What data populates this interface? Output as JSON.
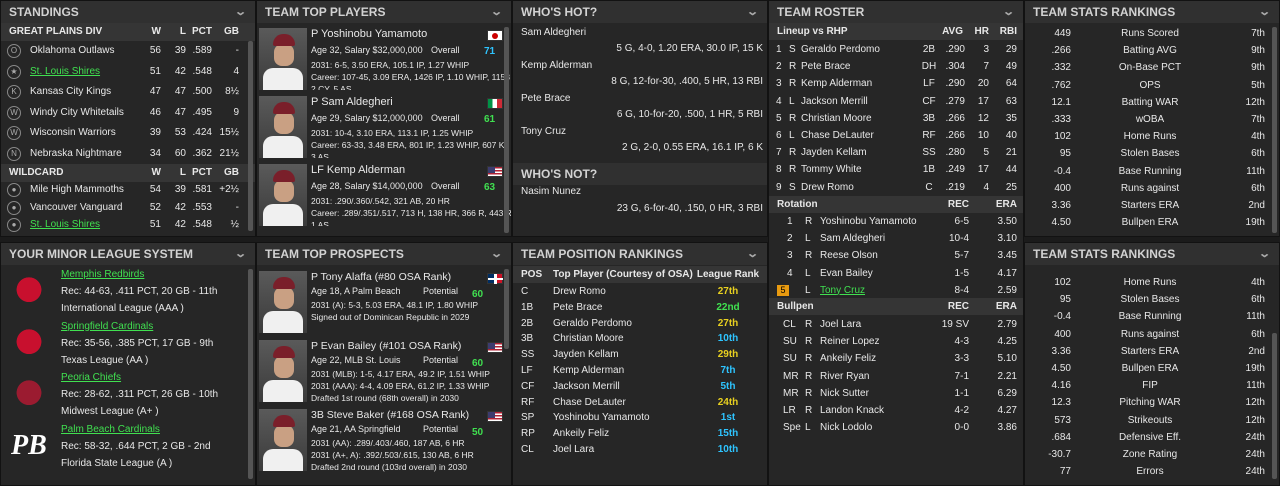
{
  "standings": {
    "title": "STANDINGS",
    "div_name": "GREAT PLAINS DIV",
    "wc_name": "WILDCARD",
    "hdr": {
      "w": "W",
      "l": "L",
      "pct": "PCT",
      "gb": "GB"
    },
    "div": [
      {
        "team": "Oklahoma Outlaws",
        "w": "56",
        "l": "39",
        "pct": ".589",
        "gb": "-"
      },
      {
        "team": "St. Louis Shires",
        "w": "51",
        "l": "42",
        "pct": ".548",
        "gb": "4"
      },
      {
        "team": "Kansas City Kings",
        "w": "47",
        "l": "47",
        "pct": ".500",
        "gb": "8½"
      },
      {
        "team": "Windy City Whitetails",
        "w": "46",
        "l": "47",
        "pct": ".495",
        "gb": "9"
      },
      {
        "team": "Wisconsin Warriors",
        "w": "39",
        "l": "53",
        "pct": ".424",
        "gb": "15½"
      },
      {
        "team": "Nebraska Nightmare",
        "w": "34",
        "l": "60",
        "pct": ".362",
        "gb": "21½"
      }
    ],
    "wc": [
      {
        "team": "Mile High Mammoths",
        "w": "54",
        "l": "39",
        "pct": ".581",
        "gb": "+2½"
      },
      {
        "team": "Vancouver Vanguard",
        "w": "52",
        "l": "42",
        "pct": ".553",
        "gb": "-"
      },
      {
        "team": "St. Louis Shires",
        "w": "51",
        "l": "42",
        "pct": ".548",
        "gb": "½"
      }
    ]
  },
  "top_players": {
    "title": "TEAM TOP PLAYERS",
    "players": [
      {
        "name": "P Yoshinobu Yamamoto",
        "info": "Age 32, Salary $32,000,000",
        "ov_label": "Overall",
        "ov": "71",
        "l1": "2031: 6-5, 3.50 ERA, 105.1 IP, 1.27 WHIP",
        "l2": "Career: 107-45, 3.09 ERA, 1426 IP, 1.10 WHIP, 1153",
        "l3": "2 CY, 5 AS",
        "flag": "jp"
      },
      {
        "name": "P Sam Aldegheri",
        "info": "Age 29, Salary $12,000,000",
        "ov_label": "Overall",
        "ov": "61",
        "l1": "2031: 10-4, 3.10 ERA, 113.1 IP, 1.25 WHIP",
        "l2": "Career: 63-33, 3.48 ERA, 801 IP, 1.23 WHIP, 607 K",
        "l3": "3 AS",
        "flag": "it"
      },
      {
        "name": "LF Kemp Alderman",
        "info": "Age 28, Salary $14,000,000",
        "ov_label": "Overall",
        "ov": "63",
        "l1": "2031: .290/.360/.542, 321 AB, 20 HR",
        "l2": "Career: .289/.351/.517, 713 H, 138 HR, 366 R, 443 R",
        "l3": "1 AS",
        "flag": "us"
      }
    ]
  },
  "whos_hot": {
    "title": "WHO'S HOT?",
    "players": [
      {
        "name": "Sam Aldegheri",
        "stat": "5 G, 4-0, 1.20 ERA, 30.0 IP, 15 K"
      },
      {
        "name": "Kemp Alderman",
        "stat": "8 G, 12-for-30, .400, 5 HR, 13 RBI"
      },
      {
        "name": "Pete Brace",
        "stat": "6 G, 10-for-20, .500, 1 HR, 5 RBI"
      },
      {
        "name": "Tony Cruz",
        "stat": "2 G, 2-0, 0.55 ERA, 16.1 IP, 6 K"
      }
    ],
    "not_title": "WHO'S NOT?",
    "not_players": [
      {
        "name": "Nasim Nunez",
        "stat": "23 G, 6-for-40, .150, 0 HR, 3 RBI"
      }
    ]
  },
  "roster": {
    "title": "TEAM ROSTER",
    "lineup_hdr": "Lineup vs RHP",
    "lh": {
      "avg": "AVG",
      "hr": "HR",
      "rbi": "RBI"
    },
    "lineup": [
      {
        "n": "1",
        "b": "S",
        "name": "Geraldo Perdomo",
        "pos": "2B",
        "avg": ".290",
        "hr": "3",
        "rbi": "29"
      },
      {
        "n": "2",
        "b": "R",
        "name": "Pete Brace",
        "pos": "DH",
        "avg": ".304",
        "hr": "7",
        "rbi": "49"
      },
      {
        "n": "3",
        "b": "R",
        "name": "Kemp Alderman",
        "pos": "LF",
        "avg": ".290",
        "hr": "20",
        "rbi": "64"
      },
      {
        "n": "4",
        "b": "L",
        "name": "Jackson Merrill",
        "pos": "CF",
        "avg": ".279",
        "hr": "17",
        "rbi": "63"
      },
      {
        "n": "5",
        "b": "R",
        "name": "Christian Moore",
        "pos": "3B",
        "avg": ".266",
        "hr": "12",
        "rbi": "35"
      },
      {
        "n": "6",
        "b": "L",
        "name": "Chase DeLauter",
        "pos": "RF",
        "avg": ".266",
        "hr": "10",
        "rbi": "40"
      },
      {
        "n": "7",
        "b": "R",
        "name": "Jayden Kellam",
        "pos": "SS",
        "avg": ".280",
        "hr": "5",
        "rbi": "21"
      },
      {
        "n": "8",
        "b": "R",
        "name": "Tommy White",
        "pos": "1B",
        "avg": ".249",
        "hr": "17",
        "rbi": "44"
      },
      {
        "n": "9",
        "b": "S",
        "name": "Drew Romo",
        "pos": "C",
        "avg": ".219",
        "hr": "4",
        "rbi": "25"
      }
    ],
    "rot_hdr": "Rotation",
    "rh": {
      "rec": "REC",
      "era": "ERA"
    },
    "rotation": [
      {
        "n": "1",
        "t": "R",
        "name": "Yoshinobu Yamamoto",
        "rec": "6-5",
        "era": "3.50"
      },
      {
        "n": "2",
        "t": "L",
        "name": "Sam Aldegheri",
        "rec": "10-4",
        "era": "3.10"
      },
      {
        "n": "3",
        "t": "R",
        "name": "Reese Olson",
        "rec": "5-7",
        "era": "3.45"
      },
      {
        "n": "4",
        "t": "L",
        "name": "Evan Bailey",
        "rec": "1-5",
        "era": "4.17"
      },
      {
        "n": "5",
        "t": "L",
        "name": "Tony Cruz",
        "rec": "8-4",
        "era": "2.59"
      }
    ],
    "bp_hdr": "Bullpen",
    "bh": {
      "rec": "REC",
      "era": "ERA"
    },
    "bullpen": [
      {
        "r": "CL",
        "t": "R",
        "name": "Joel Lara",
        "rec": "19 SV",
        "era": "2.79"
      },
      {
        "r": "SU",
        "t": "R",
        "name": "Reiner Lopez",
        "rec": "4-3",
        "era": "4.25"
      },
      {
        "r": "SU",
        "t": "R",
        "name": "Ankeily Feliz",
        "rec": "3-3",
        "era": "5.10"
      },
      {
        "r": "MR",
        "t": "R",
        "name": "River Ryan",
        "rec": "7-1",
        "era": "2.21"
      },
      {
        "r": "MR",
        "t": "R",
        "name": "Nick Sutter",
        "rec": "1-1",
        "era": "6.29"
      },
      {
        "r": "LR",
        "t": "R",
        "name": "Landon Knack",
        "rec": "4-2",
        "era": "4.27"
      },
      {
        "r": "Spe",
        "t": "L",
        "name": "Nick Lodolo",
        "rec": "0-0",
        "era": "3.86"
      }
    ]
  },
  "stats1": {
    "title": "TEAM STATS RANKINGS",
    "rows": [
      {
        "v": "449",
        "s": "Runs Scored",
        "r": "7th"
      },
      {
        "v": ".266",
        "s": "Batting AVG",
        "r": "9th"
      },
      {
        "v": ".332",
        "s": "On-Base PCT",
        "r": "9th"
      },
      {
        "v": ".762",
        "s": "OPS",
        "r": "5th"
      },
      {
        "v": "12.1",
        "s": "Batting WAR",
        "r": "12th"
      },
      {
        "v": ".333",
        "s": "wOBA",
        "r": "7th"
      },
      {
        "v": "102",
        "s": "Home Runs",
        "r": "4th"
      },
      {
        "v": "95",
        "s": "Stolen Bases",
        "r": "6th"
      },
      {
        "v": "-0.4",
        "s": "Base Running",
        "r": "11th"
      },
      {
        "v": "400",
        "s": "Runs against",
        "r": "6th"
      },
      {
        "v": "3.36",
        "s": "Starters ERA",
        "r": "2nd"
      },
      {
        "v": "4.50",
        "s": "Bullpen ERA",
        "r": "19th"
      }
    ]
  },
  "minors": {
    "title": "YOUR MINOR LEAGUE SYSTEM",
    "teams": [
      {
        "name": "Memphis Redbirds",
        "rec": "Rec: 44-63, .411 PCT, 20 GB - 11th",
        "lg": "International League (AAA )"
      },
      {
        "name": "Springfield Cardinals",
        "rec": "Rec: 35-56, .385 PCT, 17 GB - 9th",
        "lg": "Texas League (AA )"
      },
      {
        "name": "Peoria Chiefs",
        "rec": "Rec: 28-62, .311 PCT, 26 GB - 10th",
        "lg": "Midwest League (A+ )"
      },
      {
        "name": "Palm Beach Cardinals",
        "rec": "Rec: 58-32, .644 PCT, 2 GB - 2nd",
        "lg": "Florida State League (A )"
      }
    ]
  },
  "prospects": {
    "title": "TEAM TOP PROSPECTS",
    "players": [
      {
        "name": "P Tony Alaffa (#80 OSA Rank)",
        "info": "Age 18, A Palm Beach",
        "pot_label": "Potential",
        "pot": "60",
        "l1": "2031 (A): 5-3, 5.03 ERA, 48.1 IP, 1.80 WHIP",
        "l2": "Signed out of Dominican Republic in 2029",
        "l3": "",
        "flag": "do"
      },
      {
        "name": "P Evan Bailey (#101 OSA Rank)",
        "info": "Age 22, MLB St. Louis",
        "pot_label": "Potential",
        "pot": "60",
        "l1": "2031 (MLB): 1-5, 4.17 ERA, 49.2 IP, 1.51 WHIP",
        "l2": "2031 (AAA): 4-4, 4.09 ERA, 61.2 IP, 1.33 WHIP",
        "l3": "Drafted 1st round (68th overall) in 2030",
        "flag": "us"
      },
      {
        "name": "3B Steve Baker (#168 OSA Rank)",
        "info": "Age 21, AA Springfield",
        "pot_label": "Potential",
        "pot": "50",
        "l1": "2031 (AA): .289/.403/.460, 187 AB, 6 HR",
        "l2": "2031 (A+, A): .392/.503/.615, 130 AB, 6 HR",
        "l3": "Drafted 2nd round (103rd overall) in 2030",
        "flag": "us"
      }
    ]
  },
  "posrank": {
    "title": "TEAM POSITION RANKINGS",
    "hdr": {
      "pos": "POS",
      "player": "Top Player (Courtesy of OSA)",
      "rank": "League Rank"
    },
    "rows": [
      {
        "pos": "C",
        "p": "Drew Romo",
        "r": "27th",
        "c": "yellow"
      },
      {
        "pos": "1B",
        "p": "Pete Brace",
        "r": "22nd",
        "c": "green"
      },
      {
        "pos": "2B",
        "p": "Geraldo Perdomo",
        "r": "27th",
        "c": "yellow"
      },
      {
        "pos": "3B",
        "p": "Christian Moore",
        "r": "10th",
        "c": "cyan"
      },
      {
        "pos": "SS",
        "p": "Jayden Kellam",
        "r": "29th",
        "c": "yellow"
      },
      {
        "pos": "LF",
        "p": "Kemp Alderman",
        "r": "7th",
        "c": "cyan"
      },
      {
        "pos": "CF",
        "p": "Jackson Merrill",
        "r": "5th",
        "c": "cyan"
      },
      {
        "pos": "RF",
        "p": "Chase DeLauter",
        "r": "24th",
        "c": "yellow"
      },
      {
        "pos": "SP",
        "p": "Yoshinobu Yamamoto",
        "r": "1st",
        "c": "cyan"
      },
      {
        "pos": "RP",
        "p": "Ankeily Feliz",
        "r": "15th",
        "c": "cyan"
      },
      {
        "pos": "CL",
        "p": "Joel Lara",
        "r": "10th",
        "c": "cyan"
      }
    ]
  },
  "stats2": {
    "title": "TEAM STATS RANKINGS",
    "rows": [
      {
        "v": "102",
        "s": "Home Runs",
        "r": "4th"
      },
      {
        "v": "95",
        "s": "Stolen Bases",
        "r": "6th"
      },
      {
        "v": "-0.4",
        "s": "Base Running",
        "r": "11th"
      },
      {
        "v": "400",
        "s": "Runs against",
        "r": "6th"
      },
      {
        "v": "3.36",
        "s": "Starters ERA",
        "r": "2nd"
      },
      {
        "v": "4.50",
        "s": "Bullpen ERA",
        "r": "19th"
      },
      {
        "v": "4.16",
        "s": "FIP",
        "r": "11th"
      },
      {
        "v": "12.3",
        "s": "Pitching WAR",
        "r": "12th"
      },
      {
        "v": "573",
        "s": "Strikeouts",
        "r": "12th"
      },
      {
        "v": ".684",
        "s": "Defensive Eff.",
        "r": "24th"
      },
      {
        "v": "-30.7",
        "s": "Zone Rating",
        "r": "24th"
      },
      {
        "v": "77",
        "s": "Errors",
        "r": "24th"
      }
    ]
  }
}
